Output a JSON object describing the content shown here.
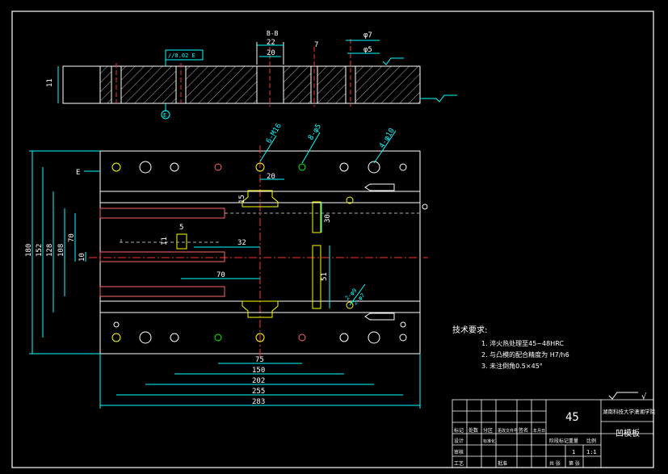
{
  "section": {
    "title": "B-B",
    "dim_22": "22",
    "dim_20": "20",
    "dim_7": "7",
    "dia_7": "φ7",
    "dia_5": "φ5",
    "thickness": "11",
    "tolerance": "//0.02 E",
    "datum": "E"
  },
  "plan": {
    "datum_e": "E",
    "hole_16": "6-M16",
    "hole_5": "8-φ5",
    "hole_10": "4-φ10",
    "dim_20": "20",
    "dim_15": "15",
    "dim_30": "30",
    "dim_5": "5",
    "dim_11": "11",
    "dim_32": "32",
    "dim_70": "70",
    "dim_51": "51",
    "pin_9": "2-φ9",
    "pin_7": "2-φ7",
    "vert": [
      "180",
      "152",
      "128",
      "108",
      "70",
      "10"
    ],
    "horiz": [
      "75",
      "150",
      "202",
      "255",
      "283"
    ]
  },
  "tech": {
    "title": "技术要求:",
    "items": [
      "1. 淬火热处理至45~48HRC",
      "2. 与凸模的配合精度为 H7/h6",
      "3. 未注倒角0.5×45°"
    ]
  },
  "roughness": "√",
  "titleblock": {
    "material": "45",
    "school": "湖南科技大学潇湘学院",
    "part_name": "凹模板",
    "scale": "1:1",
    "qty": "1",
    "row1": [
      "标记",
      "处数",
      "分区",
      "更改文件号",
      "签名",
      "年月日"
    ],
    "row2": [
      "设计",
      "",
      "标准化",
      "",
      "阶段标记",
      "重量",
      "比例"
    ],
    "row3": [
      "审核",
      "",
      "",
      ""
    ],
    "row4": [
      "工艺",
      "",
      "批准",
      "",
      "共 张",
      "第 张"
    ]
  }
}
